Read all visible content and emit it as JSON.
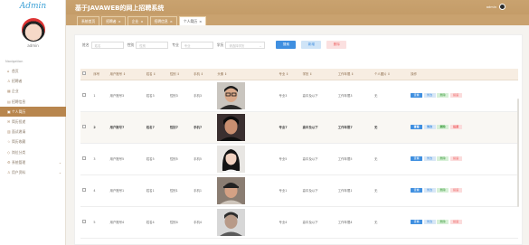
{
  "sidebar": {
    "logo": "Admin",
    "username": "admin",
    "nav_label": "Navigation",
    "items": [
      {
        "label": "首页",
        "icon": "home-icon",
        "glyph": "⌂"
      },
      {
        "label": "招聘者",
        "icon": "user-icon",
        "glyph": "♙"
      },
      {
        "label": "企业",
        "icon": "building-icon",
        "glyph": "▦"
      },
      {
        "label": "招聘信息",
        "icon": "doc-icon",
        "glyph": "▤"
      },
      {
        "label": "个人简历",
        "icon": "resume-icon",
        "glyph": "▣",
        "active": true
      },
      {
        "label": "简历投递",
        "icon": "send-icon",
        "glyph": "✉"
      },
      {
        "label": "面试邀请",
        "icon": "calendar-icon",
        "glyph": "▥"
      },
      {
        "label": "简历收藏",
        "icon": "star-icon",
        "glyph": "☆"
      },
      {
        "label": "岗位分类",
        "icon": "tag-icon",
        "glyph": "◇"
      },
      {
        "label": "系统管理",
        "icon": "gear-icon",
        "glyph": "⚙",
        "chevron": "⌄"
      },
      {
        "label": "用户资料",
        "icon": "profile-icon",
        "glyph": "♙",
        "chevron": "⌄"
      }
    ]
  },
  "header": {
    "title": "基于JAVAWEB的网上招聘系统",
    "user": "admin"
  },
  "tabs": [
    {
      "label": "系统首页"
    },
    {
      "label": "招聘者",
      "close": "×"
    },
    {
      "label": "企业",
      "close": "×"
    },
    {
      "label": "招聘信息",
      "close": "×"
    },
    {
      "label": "个人简历",
      "close": "×",
      "active": true
    }
  ],
  "search": {
    "fields": [
      {
        "label": "姓名",
        "placeholder": "姓名"
      },
      {
        "label": "性别",
        "placeholder": "性别"
      },
      {
        "label": "专业",
        "placeholder": "专业"
      }
    ],
    "select_label": "学历",
    "select_placeholder": "请选择学历",
    "search_button": "搜索",
    "add_button": "新增",
    "delete_button": "删除"
  },
  "table": {
    "columns": [
      "",
      "序号",
      "用户账号 ↕",
      "姓名 ↕",
      "性别 ↕",
      "手机 ↕",
      "头像 ↕",
      "专业 ↕",
      "学历 ↕",
      "工作年限 ↕",
      "个人图片 ↕",
      "操作"
    ],
    "actions": [
      "查看",
      "修改",
      "删除",
      "投递"
    ],
    "rows": [
      {
        "no": "1",
        "account": "用户账号3",
        "name": "姓名3",
        "gender": "性别3",
        "phone": "手机3",
        "major": "专业3",
        "edu": "高中及以下",
        "years": "工作年限3",
        "pic": "无",
        "photo": "photo-man-glasses"
      },
      {
        "no": "2",
        "account": "用户账号7",
        "name": "姓名7",
        "gender": "性别7",
        "phone": "手机7",
        "major": "专业7",
        "edu": "高中及以下",
        "years": "工作年限7",
        "pic": "无",
        "photo": "photo-man-dark",
        "shaded": true
      },
      {
        "no": "3",
        "account": "用户账号5",
        "name": "姓名5",
        "gender": "性别5",
        "phone": "手机5",
        "major": "专业5",
        "edu": "高中及以下",
        "years": "工作年限5",
        "pic": "无",
        "photo": "photo-woman"
      },
      {
        "no": "4",
        "account": "用户账号1",
        "name": "姓名1",
        "gender": "性别1",
        "phone": "手机1",
        "major": "专业1",
        "edu": "高中及以下",
        "years": "工作年限1",
        "pic": "无",
        "photo": "photo-man-cap"
      },
      {
        "no": "5",
        "account": "用户账号4",
        "name": "姓名4",
        "gender": "性别4",
        "phone": "手机4",
        "major": "专业4",
        "edu": "高中及以下",
        "years": "工作年限4",
        "pic": "无",
        "photo": "photo-man-gray"
      }
    ]
  }
}
